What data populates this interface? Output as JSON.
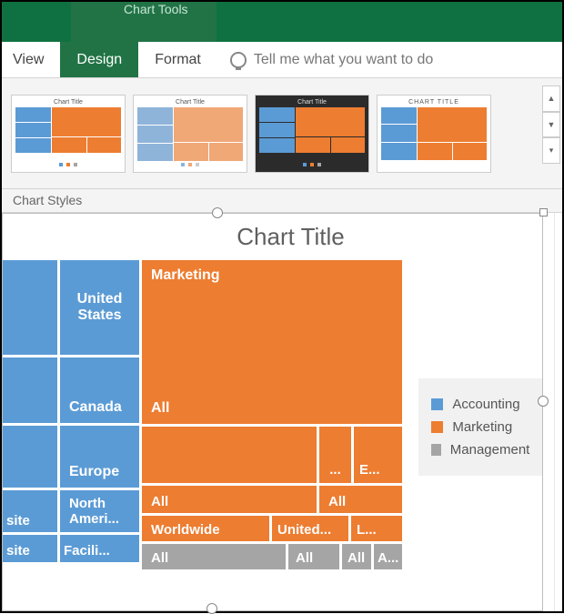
{
  "titlebar": {
    "chart_tools": "Chart Tools"
  },
  "tabs": {
    "view": "View",
    "design": "Design",
    "format": "Format",
    "tellme": "Tell me what you want to do"
  },
  "gallery": {
    "group_label": "Chart Styles",
    "thumb_title": "Chart Title",
    "thumb_title_caps": "CHART TITLE"
  },
  "chart": {
    "title": "Chart Title"
  },
  "legend": {
    "items": [
      {
        "label": "Accounting",
        "color": "#5b9bd5"
      },
      {
        "label": "Marketing",
        "color": "#ed7d31"
      },
      {
        "label": "Management",
        "color": "#a5a5a5"
      }
    ]
  },
  "treemap": {
    "blue": {
      "r1": "United States",
      "r2": "Canada",
      "r3": "Europe",
      "r4a": "site",
      "r4b": "North Ameri...",
      "r5a": "site",
      "r5b": "Facili..."
    },
    "orange": {
      "big_top": "Marketing",
      "big_bot": "All",
      "row2_b": "...",
      "row2_c": "E...",
      "row3_a": "All",
      "row3_b": "All",
      "row4_a": "Worldwide",
      "row4_b": "United...",
      "row4_c": "L..."
    },
    "gray": {
      "a": "All",
      "b": "All",
      "c": "All",
      "d": "A..."
    }
  },
  "chart_data": {
    "type": "treemap",
    "title": "Chart Title",
    "series": [
      {
        "name": "Accounting",
        "color": "#5b9bd5",
        "items": [
          {
            "label": "United States",
            "value": 100
          },
          {
            "label": "Canada",
            "value": 70
          },
          {
            "label": "Europe",
            "value": 65
          },
          {
            "label": "site",
            "value": 20
          },
          {
            "label": "North America",
            "value": 40
          },
          {
            "label": "site",
            "value": 16
          },
          {
            "label": "Facilities",
            "value": 26
          }
        ]
      },
      {
        "name": "Marketing",
        "color": "#ed7d31",
        "items": [
          {
            "label": "Marketing / All",
            "value": 420
          },
          {
            "label": "All",
            "value": 110
          },
          {
            "label": "...",
            "value": 22
          },
          {
            "label": "E...",
            "value": 28
          },
          {
            "label": "All",
            "value": 55
          },
          {
            "label": "All",
            "value": 24
          },
          {
            "label": "Worldwide",
            "value": 38
          },
          {
            "label": "United...",
            "value": 24
          },
          {
            "label": "L...",
            "value": 12
          }
        ]
      },
      {
        "name": "Management",
        "color": "#a5a5a5",
        "items": [
          {
            "label": "All",
            "value": 40
          },
          {
            "label": "All",
            "value": 16
          },
          {
            "label": "All",
            "value": 10
          },
          {
            "label": "A...",
            "value": 8
          }
        ]
      }
    ]
  }
}
